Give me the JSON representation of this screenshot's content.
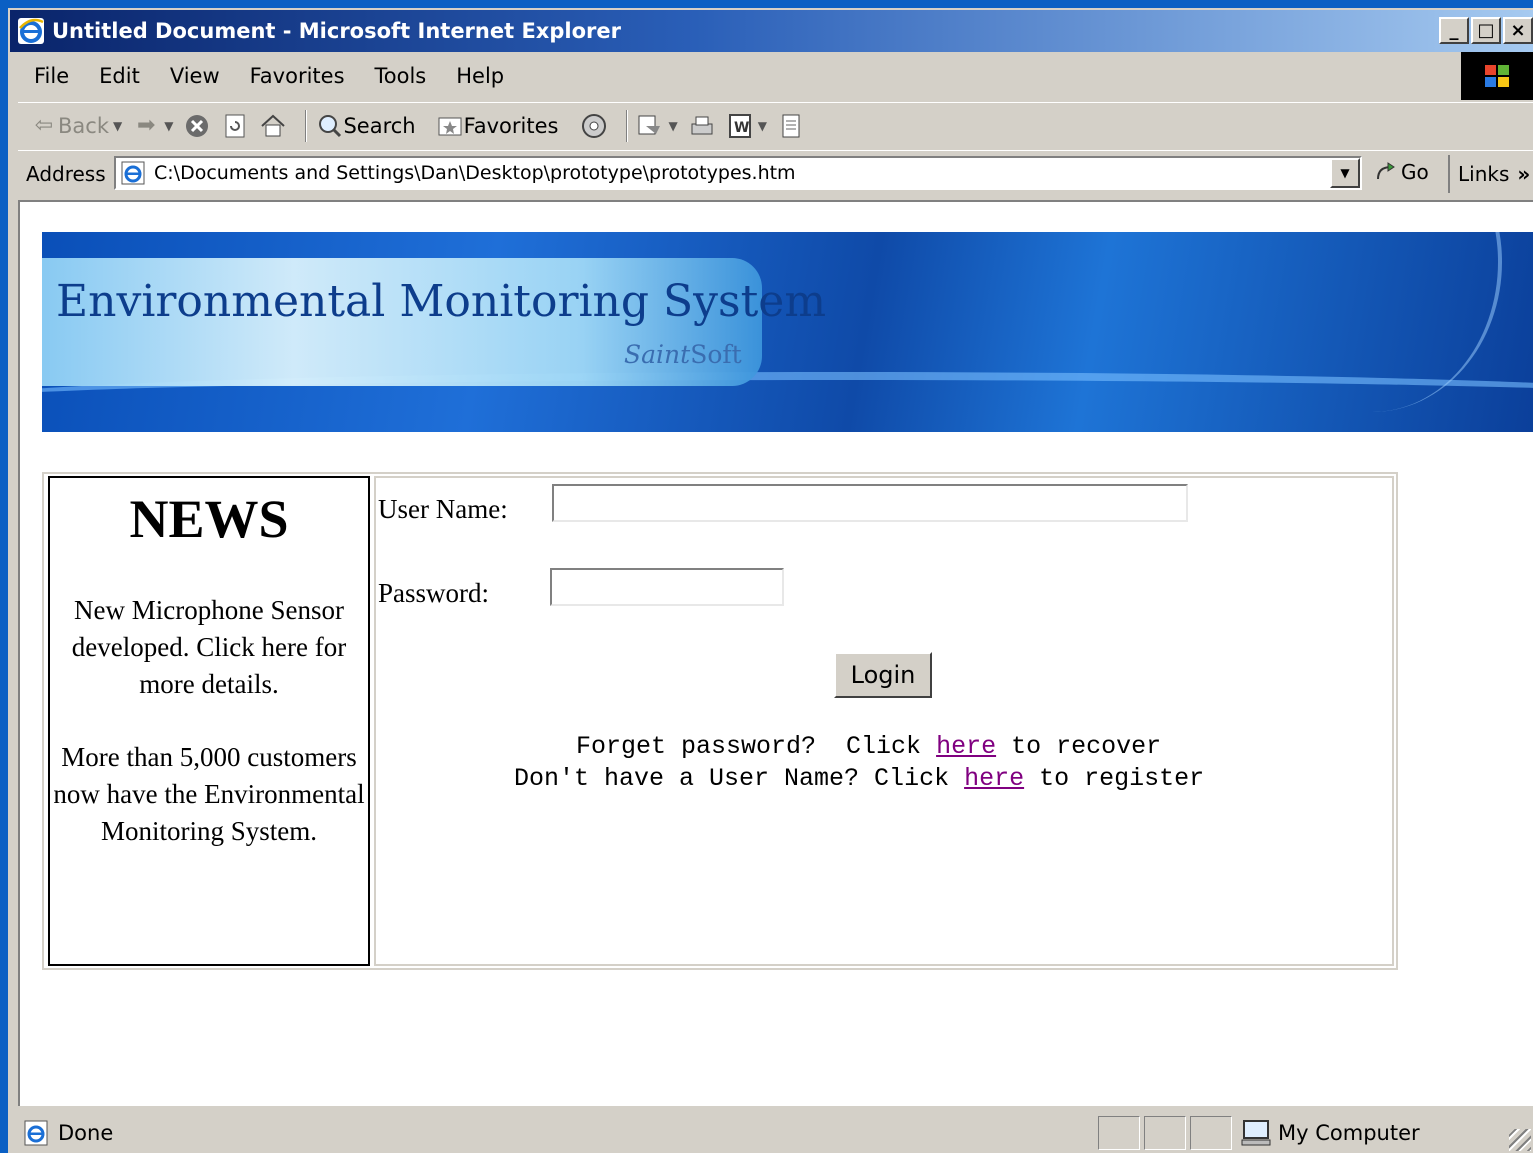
{
  "window": {
    "title": "Untitled Document - Microsoft Internet Explorer",
    "controls": [
      "_",
      "□",
      "×"
    ]
  },
  "menu": [
    "File",
    "Edit",
    "View",
    "Favorites",
    "Tools",
    "Help"
  ],
  "toolbar": {
    "back": "Back",
    "search": "Search",
    "favorites": "Favorites"
  },
  "address": {
    "label": "Address",
    "value": "C:\\Documents and Settings\\Dan\\Desktop\\prototype\\prototypes.htm",
    "go": "Go",
    "links": "Links"
  },
  "banner": {
    "title": "Environmental Monitoring System",
    "brand_italic": "Saint",
    "brand_rest": "Soft"
  },
  "news": {
    "heading": "NEWS",
    "item1": "New Microphone Sensor developed.  Click here for more details.",
    "item2": "More than 5,000 customers now have the Environmental Monitoring System."
  },
  "login": {
    "username_label": "User Name:",
    "password_label": "Password:",
    "button": "Login",
    "forgot_pre": "Forget password?  Click ",
    "forgot_link": "here",
    "forgot_post": " to recover",
    "register_pre": "Don't have a User Name? Click ",
    "register_link": "here",
    "register_post": " to register"
  },
  "status": {
    "text": "Done",
    "zone": "My Computer"
  },
  "colors": {
    "desktop": "#0a5fc4",
    "chrome": "#d4d0c8",
    "link": "#800080",
    "banner_title": "#0d3d8c"
  }
}
